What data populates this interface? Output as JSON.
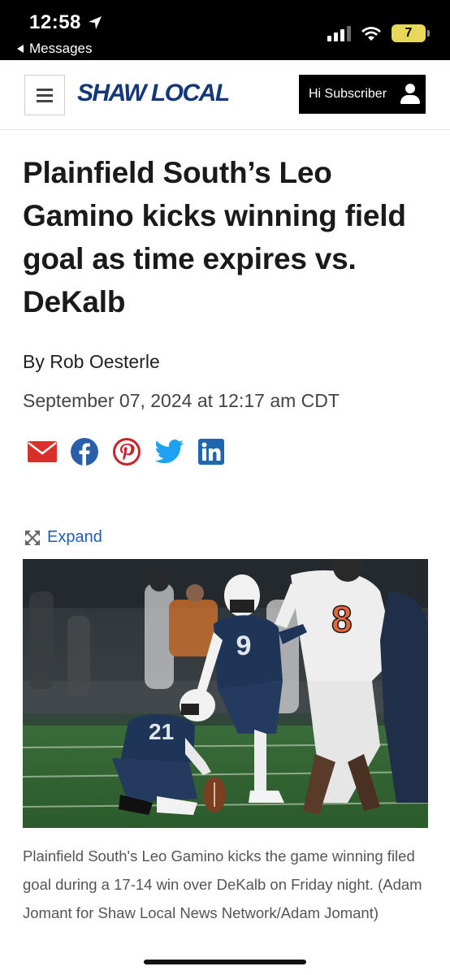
{
  "status_bar": {
    "time": "12:58",
    "back_label": "Messages",
    "battery": "7"
  },
  "header": {
    "logo": "SHAW LOCAL",
    "subscriber_label": "Hi Subscriber"
  },
  "article": {
    "headline": "Plainfield South’s Leo Gamino kicks winning field goal as time expires vs. DeKalb",
    "byline": "By Rob Oesterle",
    "date": "September 07, 2024 at 12:17 am CDT",
    "share_icons": [
      "email-icon",
      "facebook-icon",
      "pinterest-icon",
      "twitter-icon",
      "linkedin-icon"
    ],
    "expand_label": "Expand",
    "caption": "Plainfield South's Leo Gamino kicks the game winning filed goal during a 17-14 win over DeKalb on Friday night. (Adam Jomant for Shaw Local News Network/Adam Jomant)",
    "photo_numbers": {
      "kicker": "9",
      "holder": "21",
      "defender": "8"
    }
  },
  "colors": {
    "logo": "#13377a",
    "link": "#1f5fb5",
    "email": "#d9302b",
    "facebook": "#2a5ea8",
    "pinterest": "#c8232c",
    "twitter": "#1da1f2",
    "linkedin": "#1f66b0"
  }
}
